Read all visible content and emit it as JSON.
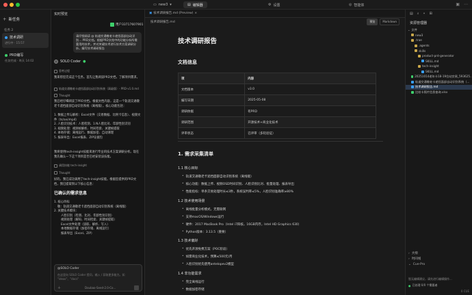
{
  "titlebar": {
    "app_name": "new3",
    "editor_tab": "编辑器",
    "settings_tab": "设置",
    "web_tab": "智能体"
  },
  "sidebar": {
    "new_task": "新任务",
    "section": "任务 2",
    "tasks": [
      {
        "title": "技术调研",
        "status": "进行中 · 15:57"
      },
      {
        "title": "PRD编写",
        "status": "任务完成 · 昨天 14:02"
      }
    ]
  },
  "chat": {
    "header": "实时预览",
    "user": "用户33717607901",
    "user_bubble": "请仔细阅读 @ 轨道交通敬老卡遮挡面部自动识别... PRD文档。根据PRD文档中的功能分析所需要用的技术，并对关键技术进行技术方案调研分析，编写技术调研报告",
    "coder_name": "SOLO Coder",
    "think1": "思考过程",
    "m1": "我来帮您完成这个任务。首先让我阅读PRD文档，了解项目需求。",
    "read_chip": "轨道交通敬老卡遮挡面部自动识别系统（高级版）- PRD-v1.0.md",
    "thought": "Thought",
    "m2": "我已经仔细阅读了PRD文档。根据文档内容，这是一个轨道交通敬老卡遮挡面部自动识别系统（离线版），核心功能包括：",
    "list": [
      "1. 数据上传与解析：Excel文件（交易数据、比例卡信息）、视频文件（ts/avi/mp4）",
      "2. 人脸识别技术：人脸检测、1:N人脸比对、年龄性别识别",
      "3. 视频处理：视频帧解析、时间检索、关键帧提取",
      "4. 本地存储：离线运行、数据加密、自动清理",
      "5. 报表导出：Excel报表、ZIP证据包"
    ],
    "m3": "我将使用tech-insight技能来进行专业的技术方案调研分析。现在我先确认一下这个项目是否已经安装该技能。",
    "chip2": "调用技能 tech-insight",
    "thought2": "Thought",
    "m4": "好的，我已成功调用了tech-insight技能。根据您提供的PRD文档，我已提取到以下核心信息：",
    "confirmed_title": "已确认的需求信息",
    "c1": "1. 核心目标",
    "c1a": "敬：轨道交通敬老卡遮挡面部自动识别系统（离线版）",
    "c2": "2. 关键技术模块：",
    "c2list": [
      "人脸识别（检测、比对、年龄性别识别）",
      "视频处理（解码、时间检索、关键帧提取）",
      "Excel文件处理（读取、解析、写入）",
      "本地数据存储（加密存储、离线运行）",
      "报表导出（Excel、ZIP）"
    ],
    "input_tag": "@SOLO Coder",
    "input_placeholder": "在这里向 SOLO Coder 提问，输入 / 获取更多能力。如 \"ideas\"、\"docs\"",
    "model": "Doubao-Seed-2.0-Co..."
  },
  "editor": {
    "file_tab": "技术调研报告.md (Preview)",
    "breadcrumb": "技术调研报告.md",
    "preview_btn": "预览",
    "markdown_btn": "Markdown",
    "h1": "技术调研报告",
    "docinfo": "文档信息",
    "table_head": [
      "项",
      "内容"
    ],
    "table_rows": [
      [
        "文档版本",
        "v3.0"
      ],
      [
        "编写日期",
        "2025-05-08"
      ],
      [
        "调研依据",
        "有PRD"
      ],
      [
        "调研范围",
        "开源技术+商业化技术"
      ],
      [
        "评审状态",
        "已评审（多轮验证）"
      ]
    ],
    "s1": "1. 需求采集清单",
    "s11": "1.1 核心目标",
    "s11list": [
      "轨道交通敬老卡遮挡面部自动识别系统（离线版）",
      "核心功能：数据上传、视频OSD时间识别、人脸识别比对、批量处理、报表导出",
      "性能指标：单条交易处理时长≤3秒，系统误判率≤5%，人脸识别准确率≥80%"
    ],
    "s12": "1.2 技术使用场景",
    "s12list": [
      "离线批量分析模式，无需联网",
      "支持macOS/Windows运行",
      "硬件：2017 MacBook Pro（Intel i7四核，16GB内存，Intel HD Graphics 630）",
      "Python版本：3.13.5（重要）"
    ],
    "s13": "1.3 技术偏好",
    "s13list": [
      "优先开源免费方案（POC阶段）",
      "如需商业化技术，预算≤500元/月",
      "人脸识别优先使用antelopev2模型"
    ],
    "s14": "1.4 非功能需求",
    "s14list": [
      "完全离线运行",
      "数据加密存储"
    ]
  },
  "explorer": {
    "title": "资源管理器",
    "items": [
      {
        "name": "文件",
        "indent": 0,
        "type": "head"
      },
      {
        "name": "new3",
        "indent": 1,
        "type": "dir"
      },
      {
        "name": ".trae",
        "indent": 1,
        "type": "dir"
      },
      {
        "name": ".agents",
        "indent": 2,
        "type": "dir"
      },
      {
        "name": "skills",
        "indent": 2,
        "type": "dir"
      },
      {
        "name": "product-prd-generator",
        "indent": 3,
        "type": "dir"
      },
      {
        "name": "SKILL.md",
        "indent": 4,
        "type": "md"
      },
      {
        "name": "tech-insight",
        "indent": 3,
        "type": "dir"
      },
      {
        "name": "SKILL.md",
        "indent": 4,
        "type": "md"
      },
      {
        "name": "20251014老年卡18-19位站交易_593625...",
        "indent": 1,
        "type": "xls"
      },
      {
        "name": "轨道交通敬老卡遮挡面部自动识别系统（...",
        "indent": 1,
        "type": "md"
      },
      {
        "name": "技术调研报告.md",
        "indent": 1,
        "type": "md",
        "selected": true
      },
      {
        "name": "比较卡照片信息查询.xlsx",
        "indent": 1,
        "type": "xls"
      }
    ],
    "outline": "大纲",
    "timeline": "时间线",
    "workspace_label": "Cue-Pro",
    "ws_line1": "智无编辑建议，请先进行编辑操作...",
    "ws_line2": "已处理 0/0 个需要者"
  },
  "status": "0 CUE"
}
